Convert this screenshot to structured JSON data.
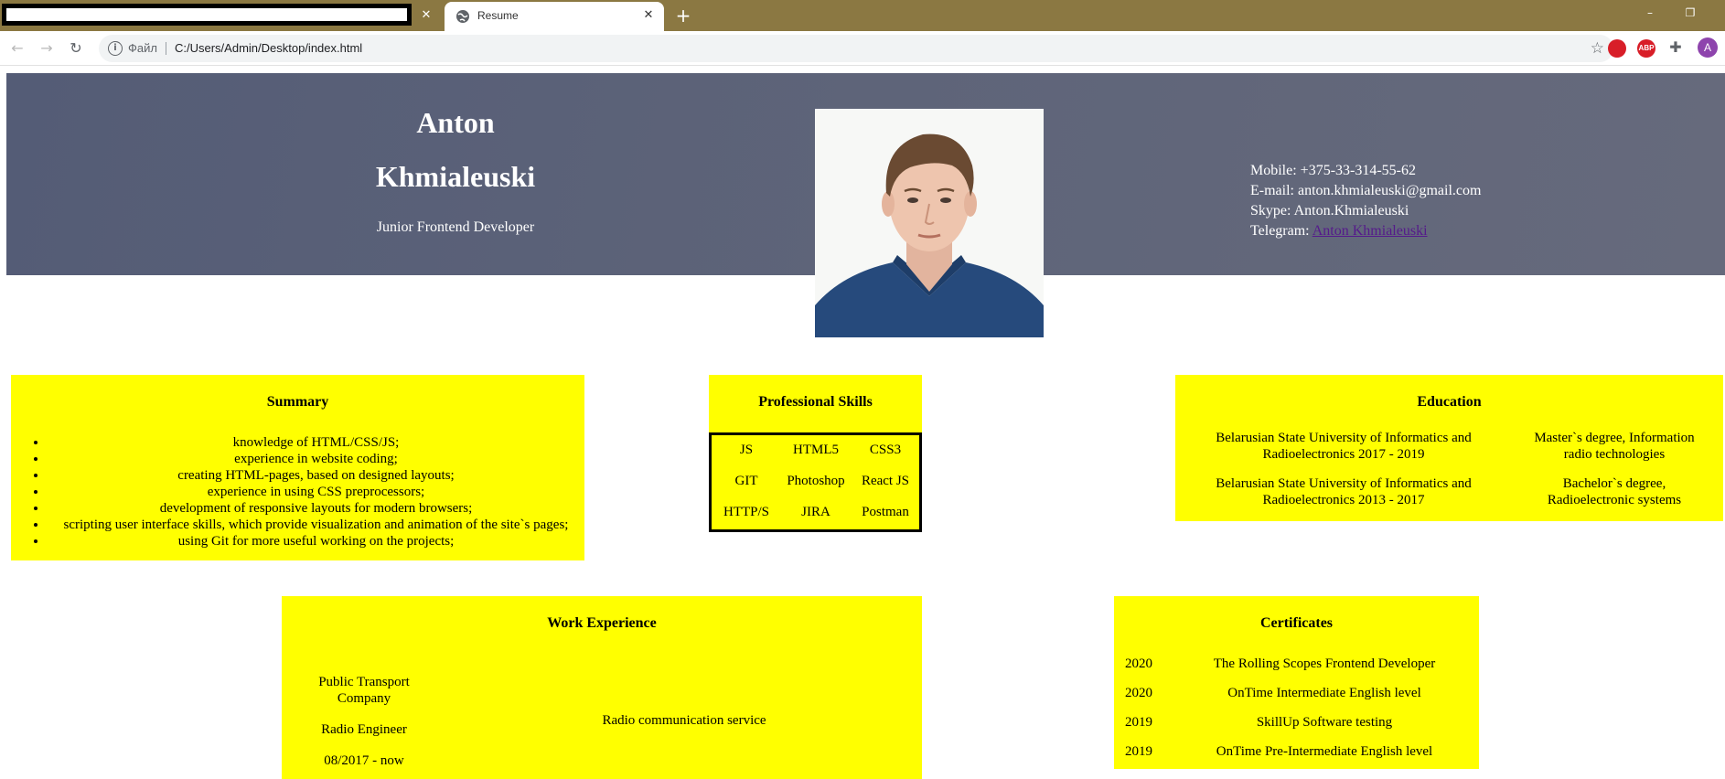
{
  "browser": {
    "tab_title": "Resume",
    "scheme_label": "Файл",
    "url": "C:/Users/Admin/Desktop/index.html",
    "extensions": [
      "adblock-icon",
      "abp-icon"
    ],
    "extension_labels": [
      "",
      "ABP"
    ],
    "profile_initial": "A",
    "accent_colors": {
      "titlebar": "#8b7842",
      "profile": "#8e44ad"
    }
  },
  "header": {
    "first_name": "Anton",
    "last_name": "Khmialeuski",
    "role": "Junior Frontend Developer",
    "contacts": {
      "mobile": "Mobile: +375-33-314-55-62",
      "email": "E-mail: anton.khmialeuski@gmail.com",
      "skype": "Skype: Anton.Khmialeuski",
      "telegram_label": "Telegram: ",
      "telegram_link": "Anton Khmialeuski"
    }
  },
  "summary": {
    "title": "Summary",
    "items": [
      "knowledge of HTML/CSS/JS;",
      "experience in website coding;",
      "creating HTML-pages, based on designed layouts;",
      "experience in using CSS preprocessors;",
      "development of responsive layouts for modern browsers;",
      "scripting user interface skills, which provide visualization and animation of the site`s pages;",
      "using Git for more useful working on the projects;"
    ]
  },
  "skills": {
    "title": "Professional Skills",
    "items": [
      "JS",
      "HTML5",
      "CSS3",
      "GIT",
      "Photoshop",
      "React JS",
      "HTTP/S",
      "JIRA",
      "Postman"
    ]
  },
  "education": {
    "title": "Education",
    "rows": [
      {
        "place": "Belarusian State University of Informatics and Radioelectronics 2017 - 2019",
        "degree": "Master`s degree, Information radio technologies"
      },
      {
        "place": "Belarusian State University of Informatics and Radioelectronics 2013 - 2017",
        "degree": "Bachelor`s degree, Radioelectronic systems"
      }
    ]
  },
  "work": {
    "title": "Work Experience",
    "company": "Public Transport Company",
    "position": "Radio Engineer",
    "period": "08/2017 - now",
    "description": "Radio communication service"
  },
  "certificates": {
    "title": "Certificates",
    "rows": [
      {
        "year": "2020",
        "name": "The Rolling Scopes Frontend Developer"
      },
      {
        "year": "2020",
        "name": "OnTime Intermediate English level"
      },
      {
        "year": "2019",
        "name": "SkillUp Software testing"
      },
      {
        "year": "2019",
        "name": "OnTime Pre-Intermediate English level"
      }
    ]
  },
  "colors": {
    "card_background": "#ffff00",
    "header_band": "#5e6479",
    "link": "#551a8b"
  }
}
